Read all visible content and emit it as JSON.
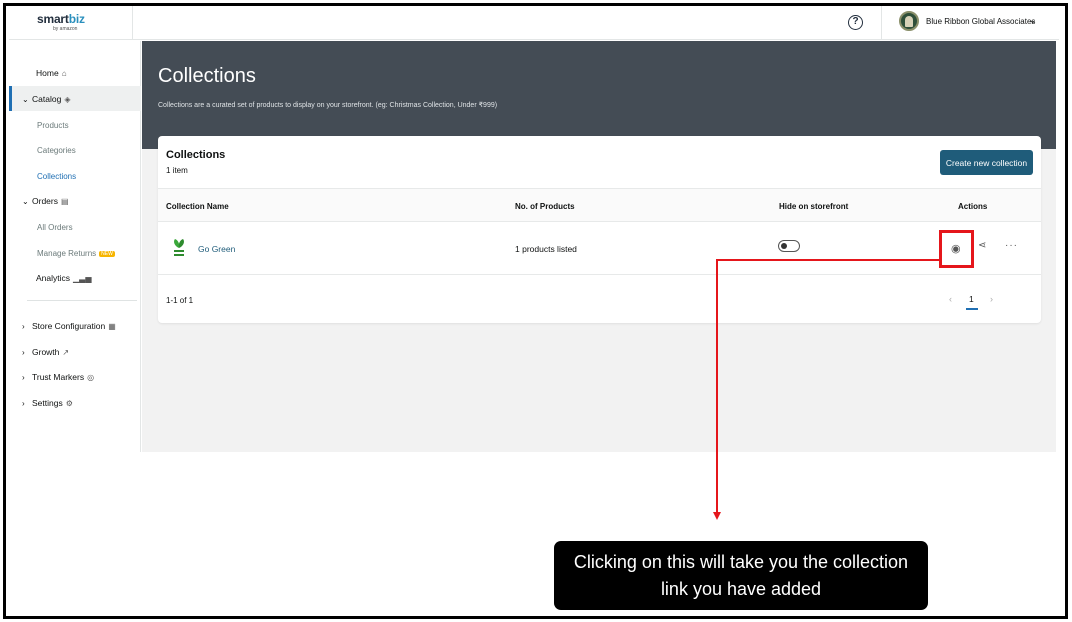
{
  "app": {
    "logo_main": "smart",
    "logo_accent": "biz",
    "logo_sub": "by amazon"
  },
  "topbar": {
    "help_label": "?",
    "account_name": "Blue Ribbon Global Associates",
    "account_chevron": "⌄"
  },
  "sidebar": {
    "items": [
      {
        "label": "Home",
        "icon": "home-icon"
      },
      {
        "label": "Catalog",
        "icon": "tag-icon",
        "expanded": true
      },
      {
        "label": "Products"
      },
      {
        "label": "Categories"
      },
      {
        "label": "Collections",
        "active": true
      },
      {
        "label": "Orders",
        "icon": "clipboard-icon",
        "expanded": true
      },
      {
        "label": "All Orders"
      },
      {
        "label": "Manage Returns",
        "badge": "NEW"
      },
      {
        "label": "Analytics",
        "icon": "bar-chart-icon"
      },
      {
        "label": "Store Configuration",
        "icon": "store-icon"
      },
      {
        "label": "Growth",
        "icon": "trend-icon"
      },
      {
        "label": "Trust Markers",
        "icon": "badge-icon"
      },
      {
        "label": "Settings",
        "icon": "gear-icon"
      }
    ]
  },
  "hero": {
    "title": "Collections",
    "subtitle": "Collections are a curated set of products to display on your storefront. (eg: Christmas Collection, Under ₹999)"
  },
  "card": {
    "title": "Collections",
    "count": "1 item",
    "create_button": "Create new collection",
    "columns": [
      "Collection Name",
      "No. of Products",
      "Hide on storefront",
      "Actions"
    ],
    "rows": [
      {
        "name": "Go Green",
        "products": "1 products listed",
        "hidden": false
      }
    ],
    "pagination": {
      "range": "1-1 of 1",
      "prev": "‹",
      "current": "1",
      "next": "›"
    }
  },
  "annotation": {
    "line1": "Clicking on this will take you the collection",
    "line2": "link you have added",
    "color": "#e5161b"
  }
}
